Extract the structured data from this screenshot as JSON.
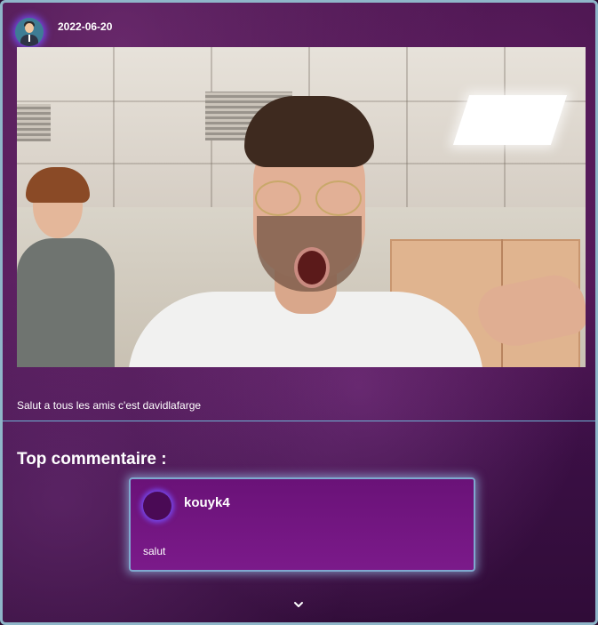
{
  "post": {
    "date": "2022-06-20",
    "author_avatar_icon": "businessman-avatar-icon",
    "caption": "Salut a tous les amis c'est davidlafarge"
  },
  "comments_section": {
    "title": "Top commentaire :",
    "top_comment": {
      "username": "kouyk4",
      "text": "salut"
    },
    "expand_icon": "chevron-down-icon"
  },
  "colors": {
    "accent_border": "#8fb6c9",
    "comment_card": "#7b1a8a",
    "avatar_glow": "#7850ff"
  }
}
